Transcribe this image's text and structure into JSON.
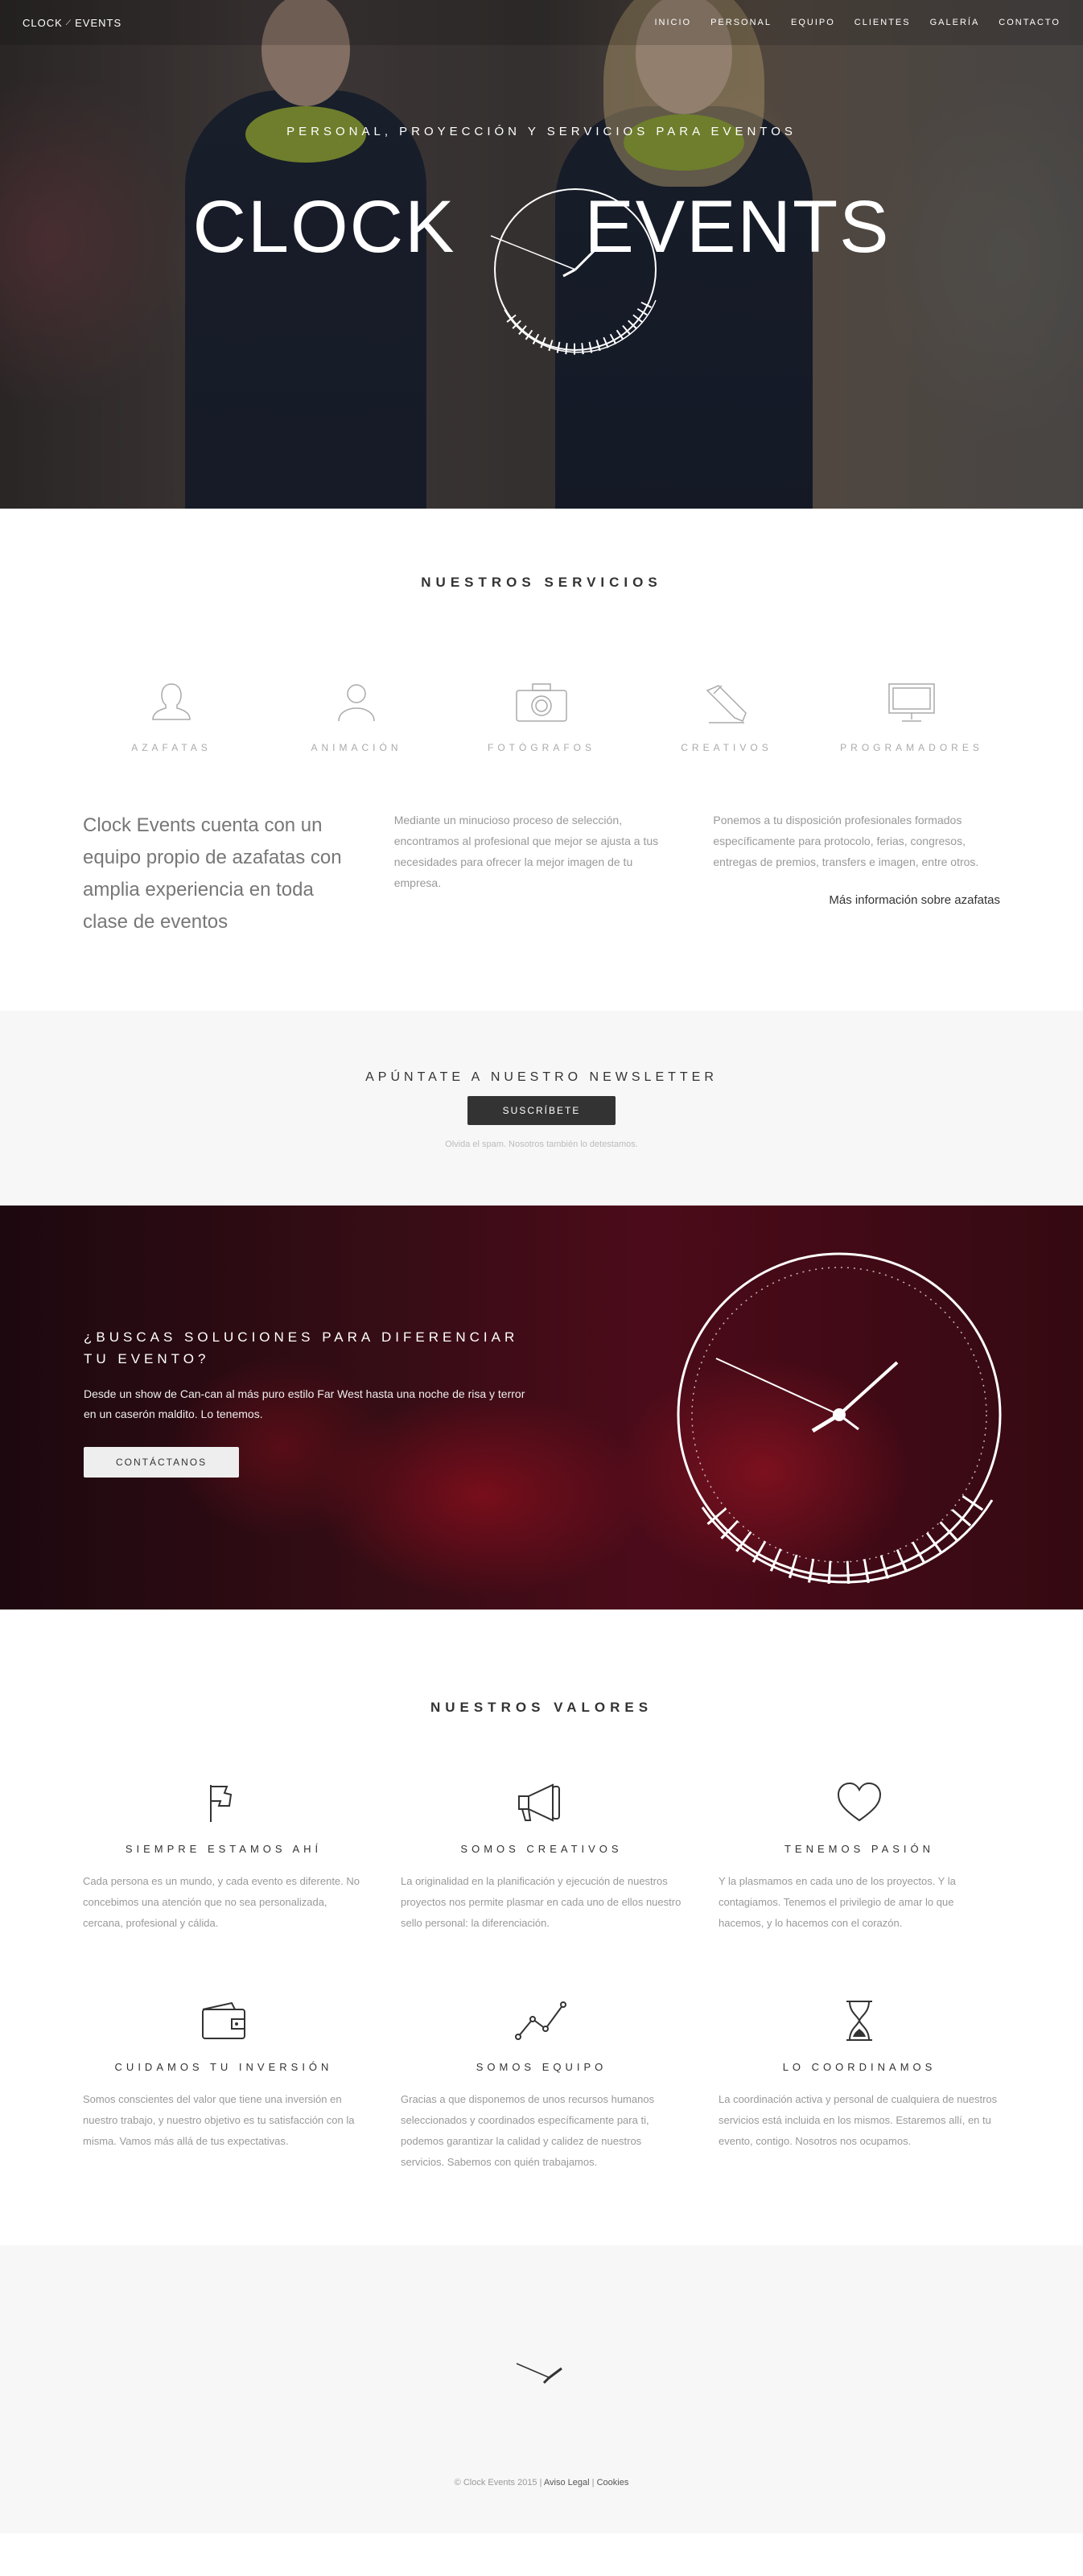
{
  "nav": {
    "logo_left": "CLOCK",
    "logo_right": "EVENTS",
    "items": [
      {
        "label": "INICIO"
      },
      {
        "label": "PERSONAL"
      },
      {
        "label": "EQUIPO"
      },
      {
        "label": "CLIENTES"
      },
      {
        "label": "GALERÍA"
      },
      {
        "label": "CONTACTO"
      }
    ]
  },
  "hero": {
    "tagline": "PERSONAL, PROYECCIÓN Y SERVICIOS PARA EVENTOS",
    "logo_left": "CLOCK",
    "logo_right": "EVENTS"
  },
  "services": {
    "title": "NUESTROS SERVICIOS",
    "items": [
      {
        "label": "AZAFATAS",
        "icon": "person-female-icon"
      },
      {
        "label": "ANIMACIÓN",
        "icon": "person-icon"
      },
      {
        "label": "FOTÓGRAFOS",
        "icon": "camera-icon"
      },
      {
        "label": "CREATIVOS",
        "icon": "pencil-icon"
      },
      {
        "label": "PROGRAMADORES",
        "icon": "monitor-icon"
      }
    ],
    "intro": "Clock Events cuenta con un equipo propio de azafatas con amplia experiencia en toda clase de eventos",
    "text_1": "Mediante un minucioso proceso de selección, encontramos al profesional que mejor se ajusta a tus necesidades para ofrecer la mejor imagen de tu empresa.",
    "text_2": "Ponemos a tu disposición profesionales formados específicamente para protocolo, ferias, congresos, entregas de premios, transfers e imagen, entre otros.",
    "more_link": "Más información sobre azafatas"
  },
  "newsletter": {
    "title": "APÚNTATE A NUESTRO NEWSLETTER",
    "button": "SUSCRÍBETE",
    "note": "Olvida el spam. Nosotros también lo detestamos."
  },
  "band": {
    "title": "¿BUSCAS SOLUCIONES PARA DIFERENCIAR TU EVENTO?",
    "text": "Desde un show de Can-can al más puro estilo Far West hasta una noche de risa y terror en un caserón maldito. Lo tenemos.",
    "button": "CONTÁCTANOS"
  },
  "values": {
    "title": "NUESTROS VALORES",
    "items": [
      {
        "icon": "flag-icon",
        "title": "SIEMPRE ESTAMOS AHÍ",
        "text": "Cada persona es un mundo, y cada evento es diferente. No concebimos una atención que no sea personalizada, cercana, profesional y cálida."
      },
      {
        "icon": "megaphone-icon",
        "title": "SOMOS CREATIVOS",
        "text": "La originalidad en la planificación y ejecución de nuestros proyectos nos permite plasmar en cada uno de ellos nuestro sello personal: la diferenciación."
      },
      {
        "icon": "heart-icon",
        "title": "TENEMOS PASIÓN",
        "text": "Y la plasmamos en cada uno de los proyectos. Y la contagiamos. Tenemos el privilegio de amar lo que hacemos, y lo hacemos con el corazón."
      },
      {
        "icon": "wallet-icon",
        "title": "CUIDAMOS TU INVERSIÓN",
        "text": "Somos conscientes del valor que tiene una inversión en nuestro trabajo, y nuestro objetivo es tu satisfacción con la misma. Vamos más allá de tus expectativas."
      },
      {
        "icon": "line-graph-icon",
        "title": "SOMOS EQUIPO",
        "text": "Gracias a que disponemos de unos recursos humanos seleccionados y coordinados específicamente para ti, podemos garantizar la calidad y calidez de nuestros servicios. Sabemos con quién trabajamos."
      },
      {
        "icon": "hourglass-icon",
        "title": "LO COORDINAMOS",
        "text": "La coordinación activa y personal de cualquiera de nuestros servicios está incluida en los mismos. Estaremos allí, en tu evento, contigo. Nosotros nos ocupamos."
      }
    ]
  },
  "footer": {
    "copyright": "© Clock Events 2015 |",
    "legal_link": "Aviso Legal",
    "separator": "|",
    "cookies_link": "Cookies"
  }
}
